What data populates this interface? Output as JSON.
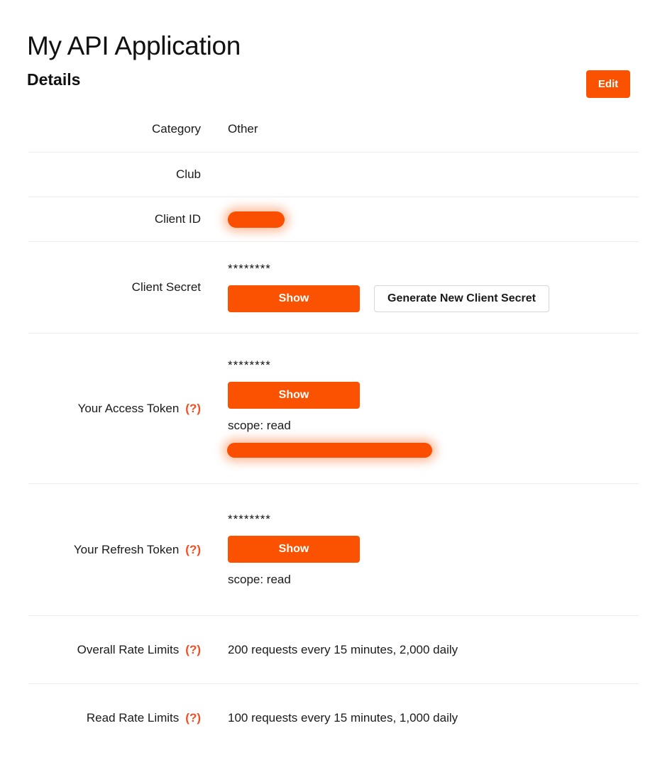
{
  "header": {
    "app_title": "My API Application",
    "section_heading": "Details",
    "edit_label": "Edit",
    "accent_color": "#fa5200",
    "help_color": "#f04e23"
  },
  "details": {
    "rows": [
      {
        "label": "Category",
        "value": "Other",
        "help": null
      },
      {
        "label": "Club",
        "value": "",
        "help": null
      },
      {
        "label": "Client ID",
        "value": "",
        "help": null,
        "redacted": "redaction-short"
      },
      {
        "label": "Client Secret",
        "masked_value": "********",
        "show_label": "Show",
        "generate_label": "Generate New Client Secret",
        "help": null
      },
      {
        "label": "Your Access Token",
        "masked_value": "********",
        "show_label": "Show",
        "scope": "scope: read",
        "help": "(?)",
        "redacted": "redaction-long"
      },
      {
        "label": "Your Refresh Token",
        "masked_value": "********",
        "show_label": "Show",
        "scope": "scope: read",
        "help": "(?)"
      },
      {
        "label": "Overall Rate Limits",
        "value": "200 requests every 15 minutes, 2,000 daily",
        "help": "(?)"
      },
      {
        "label": "Read Rate Limits",
        "value": "100 requests every 15 minutes, 1,000 daily",
        "help": "(?)"
      }
    ]
  }
}
